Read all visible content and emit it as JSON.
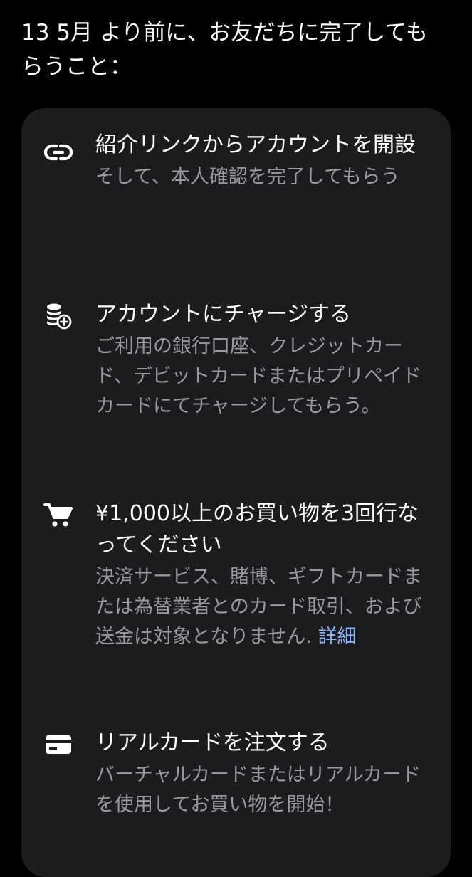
{
  "header": {
    "title": "13 5月 より前に、お友だちに完了してもらうこと："
  },
  "tasks": [
    {
      "icon": "link-icon",
      "title": "紹介リンクからアカウントを開設",
      "description": "そして、本人確認を完了してもらう"
    },
    {
      "icon": "coins-add-icon",
      "title": "アカウントにチャージする",
      "description": "ご利用の銀行口座、クレジットカード、デビットカードまたはプリペイドカードにてチャージしてもらう。"
    },
    {
      "icon": "cart-icon",
      "title": "¥1,000以上のお買い物を3回行なってください",
      "description": "決済サービス、賭博、ギフトカードまたは為替業者とのカード取引、および送金は対象となりません.",
      "link_label": "詳細"
    },
    {
      "icon": "card-icon",
      "title": "リアルカードを注文する",
      "description": "バーチャルカードまたはリアルカードを使用してお買い物を開始！"
    }
  ],
  "colors": {
    "background": "#000000",
    "card": "#1c1c1e",
    "primary_text": "#ffffff",
    "secondary_text": "#9a9a9e",
    "link": "#8ab4f8"
  }
}
